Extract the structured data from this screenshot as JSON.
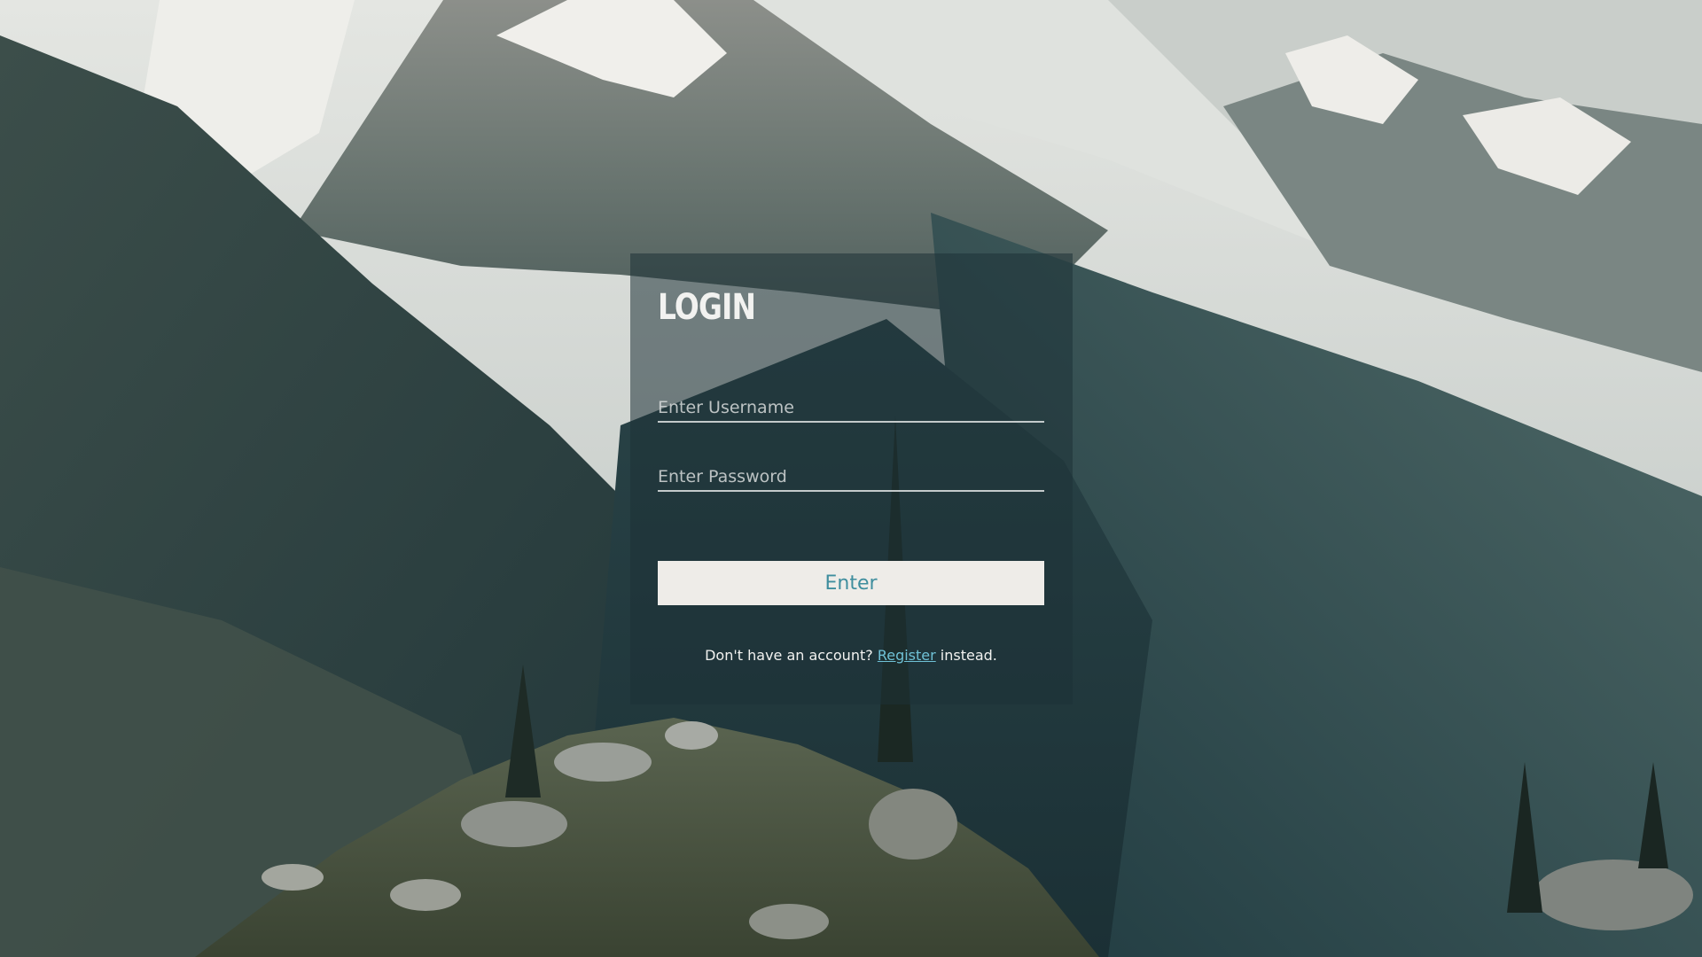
{
  "login_card": {
    "title": "LOGIN",
    "username_placeholder": "Enter Username",
    "password_placeholder": "Enter Password",
    "enter_label": "Enter",
    "footer_prefix": "Don't have an account?",
    "register_link": "Register",
    "footer_suffix": "instead."
  },
  "background": {
    "scene": "mountain-landscape"
  },
  "colors": {
    "accent": "#3f8e9e",
    "link": "#6fc1d6",
    "button_bg": "#eeece8"
  }
}
